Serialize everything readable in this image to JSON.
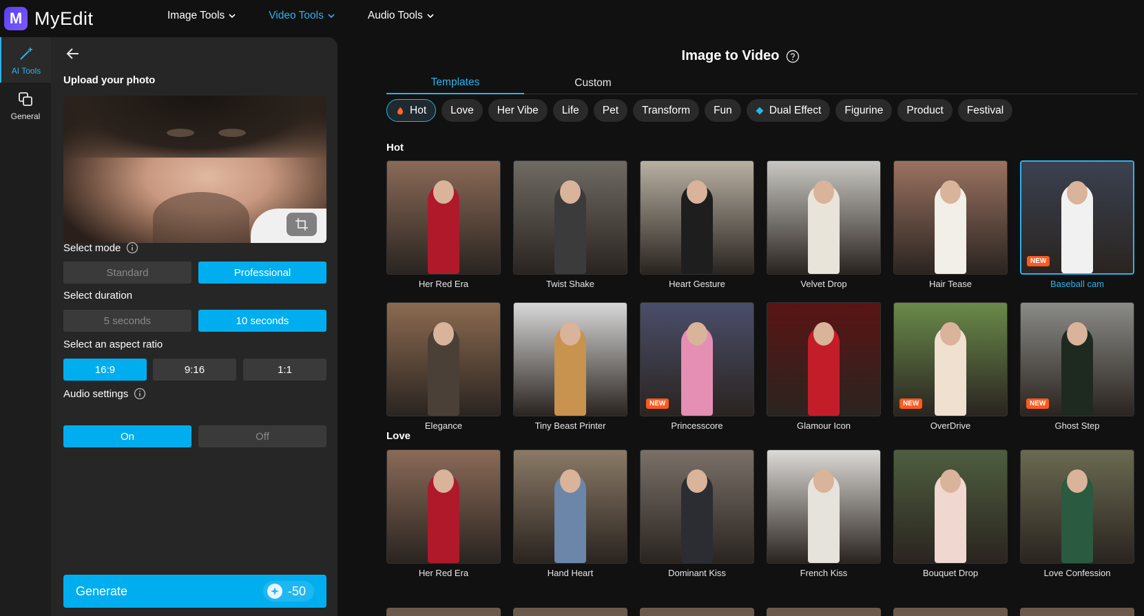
{
  "app": {
    "logo_letter": "M",
    "name": "MyEdit"
  },
  "topnav": [
    {
      "label": "Image Tools",
      "active": false
    },
    {
      "label": "Video Tools",
      "active": true
    },
    {
      "label": "Audio Tools",
      "active": false
    }
  ],
  "rail": [
    {
      "label": "AI Tools",
      "icon": "magic-wand-icon",
      "active": true
    },
    {
      "label": "General",
      "icon": "copy-icon",
      "active": false
    }
  ],
  "panel": {
    "upload_title": "Upload your photo",
    "mode": {
      "label": "Select mode",
      "options": [
        "Standard",
        "Professional"
      ],
      "selected": "Professional"
    },
    "duration": {
      "label": "Select duration",
      "options": [
        "5 seconds",
        "10 seconds"
      ],
      "selected": "10 seconds"
    },
    "aspect": {
      "label": "Select an aspect ratio",
      "options": [
        "16:9",
        "9:16",
        "1:1"
      ],
      "selected": "16:9"
    },
    "audio": {
      "label": "Audio settings",
      "options": [
        "On",
        "Off"
      ],
      "selected": "On"
    },
    "generate_label": "Generate",
    "credits": "-50"
  },
  "main": {
    "title": "Image to Video",
    "tabs": [
      {
        "label": "Templates",
        "active": true
      },
      {
        "label": "Custom",
        "active": false
      }
    ],
    "chips": [
      {
        "label": "Hot",
        "icon": "flame-icon",
        "active": true
      },
      {
        "label": "Love"
      },
      {
        "label": "Her Vibe"
      },
      {
        "label": "Life"
      },
      {
        "label": "Pet"
      },
      {
        "label": "Transform"
      },
      {
        "label": "Fun"
      },
      {
        "label": "Dual Effect",
        "icon": "diamond-icon"
      },
      {
        "label": "Figurine"
      },
      {
        "label": "Product"
      },
      {
        "label": "Festival"
      }
    ],
    "sections": [
      {
        "title": "Hot",
        "rows": [
          [
            {
              "label": "Her Red Era",
              "new": false,
              "bg": "#8a6a58",
              "fig": "#b0192a"
            },
            {
              "label": "Twist Shake",
              "new": false,
              "bg": "#6f6a63",
              "fig": "#3b3b3b"
            },
            {
              "label": "Heart Gesture",
              "new": false,
              "bg": "#b8b0a2",
              "fig": "#1e1e1e"
            },
            {
              "label": "Velvet Drop",
              "new": false,
              "bg": "#c9c7c2",
              "fig": "#e9e4da"
            },
            {
              "label": "Hair Tease",
              "new": false,
              "bg": "#9a7260",
              "fig": "#f2eee8"
            },
            {
              "label": "Baseball cam",
              "new": true,
              "selected": true,
              "bg": "#3a4150",
              "fig": "#f1f1f1"
            }
          ],
          [
            {
              "label": "Elegance",
              "new": false,
              "bg": "#8c6a50",
              "fig": "#4a4038"
            },
            {
              "label": "Tiny Beast Printer",
              "new": false,
              "bg": "#d8d8d8",
              "fig": "#c8924f"
            },
            {
              "label": "Princesscore",
              "new": true,
              "bg": "#4a4e6a",
              "fig": "#e58fb4"
            },
            {
              "label": "Glamour Icon",
              "new": false,
              "bg": "#5a1414",
              "fig": "#c41d2a"
            },
            {
              "label": "OverDrive",
              "new": true,
              "bg": "#6a8a4a",
              "fig": "#f0e0d0"
            },
            {
              "label": "Ghost Step",
              "new": true,
              "bg": "#8a8a86",
              "fig": "#1e2a20"
            }
          ]
        ]
      },
      {
        "title": "Love",
        "rows": [
          [
            {
              "label": "Her Red Era",
              "new": false,
              "bg": "#8a6a58",
              "fig": "#b0192a"
            },
            {
              "label": "Hand Heart",
              "new": false,
              "bg": "#8a7a66",
              "fig": "#6b86a8"
            },
            {
              "label": "Dominant Kiss",
              "new": false,
              "bg": "#7a7068",
              "fig": "#2b2d33"
            },
            {
              "label": "French Kiss",
              "new": false,
              "bg": "#dcdad6",
              "fig": "#e6e2dc"
            },
            {
              "label": "Bouquet Drop",
              "new": false,
              "bg": "#4e5e3e",
              "fig": "#f0d7cf"
            },
            {
              "label": "Love Confession",
              "new": false,
              "bg": "#6a6a50",
              "fig": "#2a5a40"
            }
          ]
        ]
      }
    ]
  }
}
